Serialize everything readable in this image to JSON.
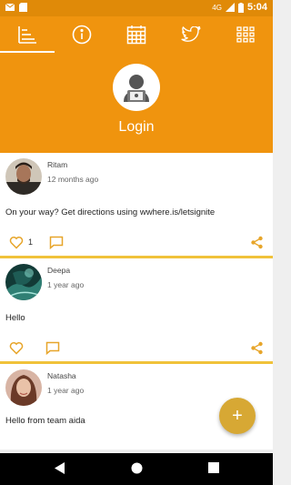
{
  "status_bar": {
    "network": "4G",
    "time": "5:04"
  },
  "tabs": [
    {
      "name": "feed",
      "icon": "feed-list-icon",
      "active": true
    },
    {
      "name": "info",
      "icon": "info-icon",
      "active": false
    },
    {
      "name": "calendar",
      "icon": "calendar-icon",
      "active": false
    },
    {
      "name": "twitter",
      "icon": "twitter-icon",
      "active": false
    },
    {
      "name": "apps",
      "icon": "grid-icon",
      "active": false
    }
  ],
  "header": {
    "login_label": "Login"
  },
  "posts": [
    {
      "author": "Ritam",
      "time": "12 months ago",
      "text": "On your way? Get directions using wwhere.is/letsignite",
      "likes": "1"
    },
    {
      "author": "Deepa",
      "time": "1 year ago",
      "text": "Hello",
      "likes": ""
    },
    {
      "author": "Natasha",
      "time": "1 year ago",
      "text": "Hello from team aida",
      "likes": ""
    }
  ],
  "fab": {
    "label": "+"
  },
  "colors": {
    "primary": "#f0940e",
    "status_bar": "#e08a08",
    "accent": "#d7a834",
    "separator": "#f0c23a"
  }
}
